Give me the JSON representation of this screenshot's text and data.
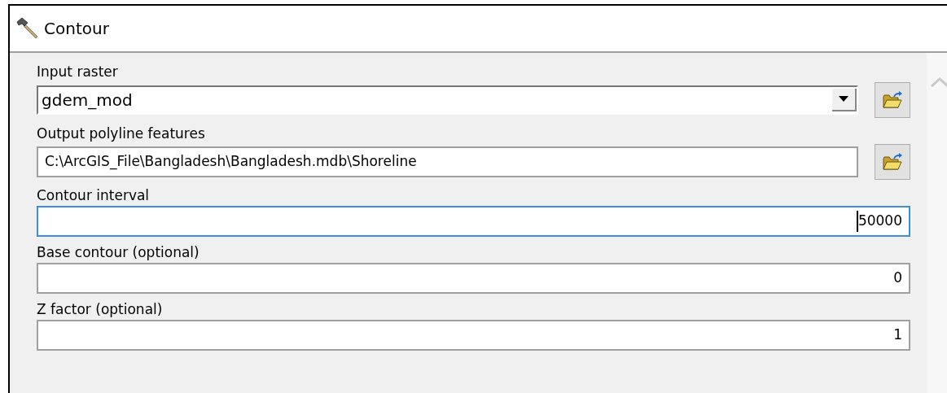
{
  "window": {
    "title": "Contour"
  },
  "parameters": [
    {
      "label": "Input raster",
      "kind": "combo",
      "value": "gdem_mod",
      "browse": true,
      "focused": false
    },
    {
      "label": "Output polyline features",
      "kind": "text",
      "value": "C:\\ArcGIS_File\\Bangladesh\\Bangladesh.mdb\\Shoreline",
      "browse": true,
      "focused": false
    },
    {
      "label": "Contour interval",
      "kind": "number",
      "value": "50000",
      "browse": false,
      "focused": true
    },
    {
      "label": "Base contour (optional)",
      "kind": "number",
      "value": "0",
      "browse": false,
      "focused": false
    },
    {
      "label": "Z factor (optional)",
      "kind": "number",
      "value": "1",
      "browse": false,
      "focused": false
    }
  ]
}
